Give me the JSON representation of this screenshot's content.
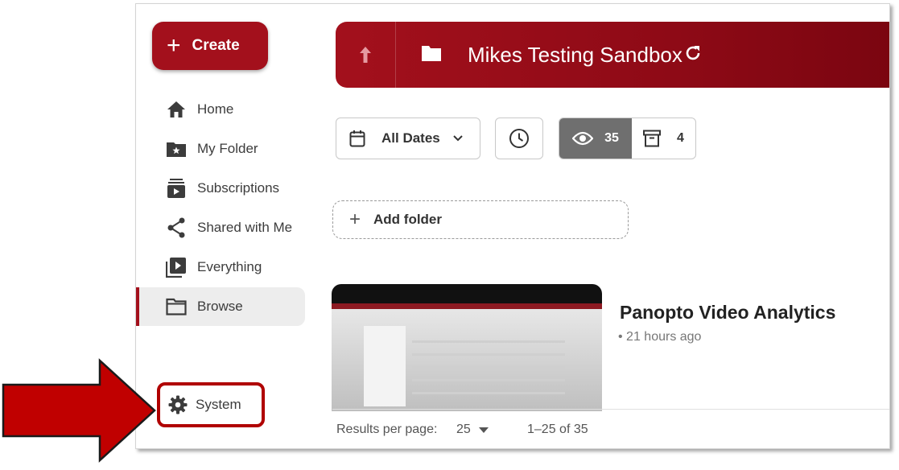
{
  "sidebar": {
    "create_label": "Create",
    "items": [
      {
        "label": "Home",
        "icon": "home-icon"
      },
      {
        "label": "My Folder",
        "icon": "star-folder-icon"
      },
      {
        "label": "Subscriptions",
        "icon": "subscriptions-icon"
      },
      {
        "label": "Shared with Me",
        "icon": "share-icon"
      },
      {
        "label": "Everything",
        "icon": "video-library-icon"
      },
      {
        "label": "Browse",
        "icon": "folder-outline-icon",
        "active": true
      }
    ],
    "system_label": "System"
  },
  "header": {
    "title": "Mikes Testing Sandbox"
  },
  "filters": {
    "dates_label": "All Dates",
    "visible_count": "35",
    "archived_count": "4"
  },
  "add_folder_label": "Add folder",
  "video": {
    "title": "Panopto Video Analytics",
    "meta": "• 21 hours ago"
  },
  "footer": {
    "results_label": "Results per page:",
    "per_page": "25",
    "range": "1–25 of 35"
  },
  "colors": {
    "brand": "#a3101c",
    "callout": "#b00000"
  }
}
